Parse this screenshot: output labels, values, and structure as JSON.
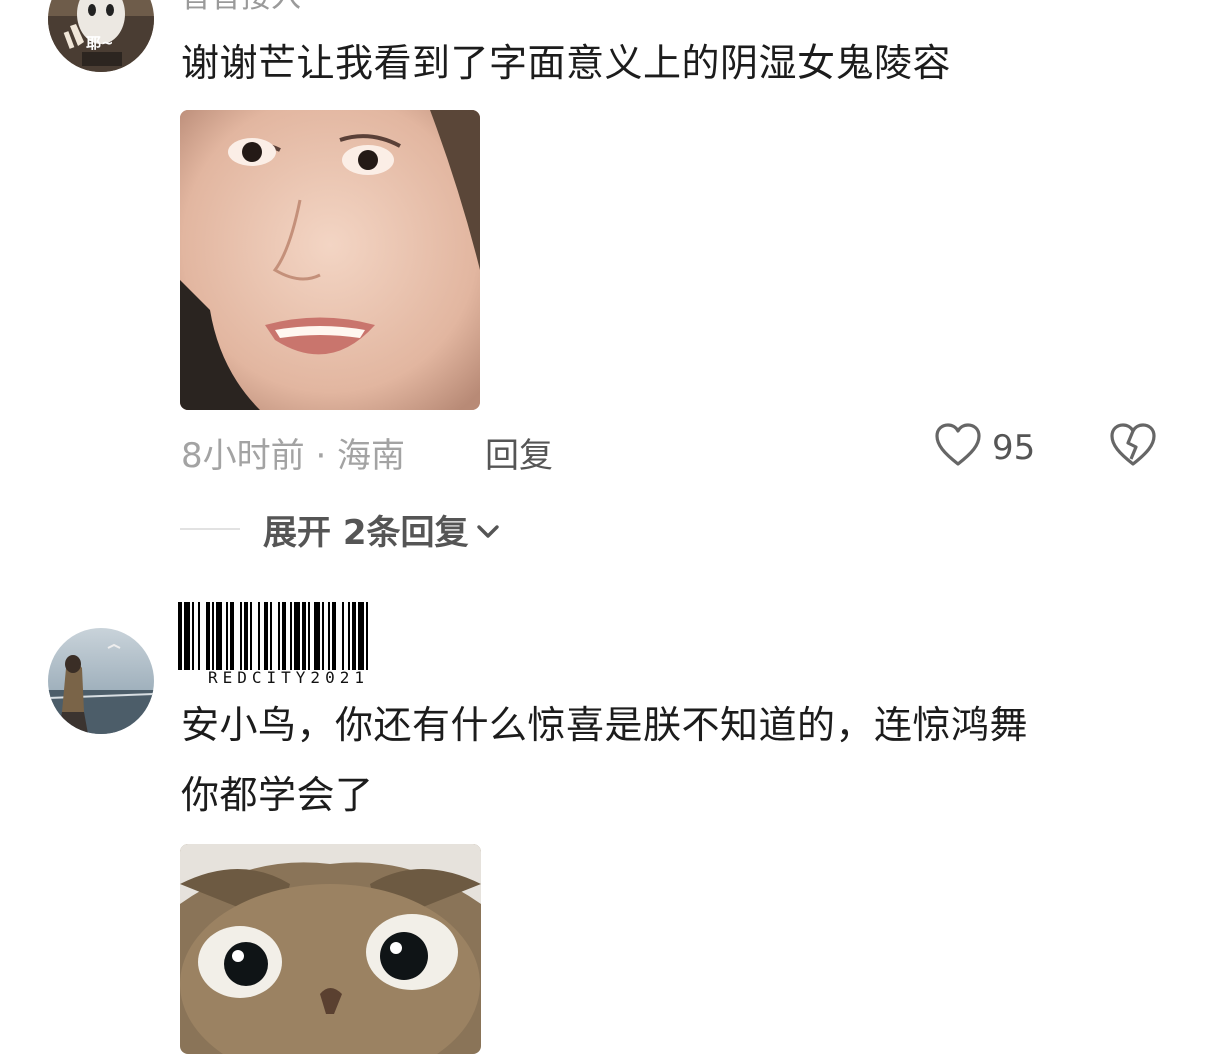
{
  "comment1": {
    "username": "音音接入",
    "avatar_text": "耶~",
    "text": "谢谢芒让我看到了字面意义上的阴湿女鬼陵容",
    "meta": "8小时前 · 海南",
    "reply_label": "回复",
    "likes": "95",
    "expand_label": "展开 2条回复"
  },
  "comment2": {
    "username_barcode_text": "REDCITY2021",
    "text_line1": "安小鸟，你还有什么惊喜是朕不知道的，连惊鸿舞",
    "text_line2": "你都学会了"
  },
  "icons": {
    "like": "heart-outline-icon",
    "dislike": "broken-heart-icon",
    "expand": "chevron-down-icon"
  }
}
